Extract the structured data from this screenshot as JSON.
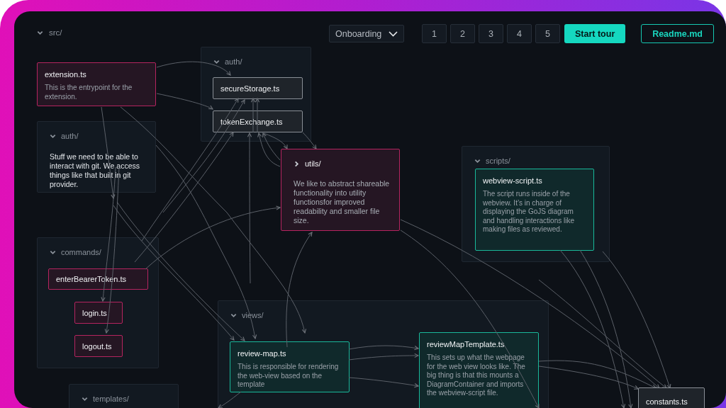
{
  "toolbar": {
    "tour_select": {
      "value": "Onboarding"
    },
    "steps": [
      {
        "label": "1",
        "selected": false
      },
      {
        "label": "2",
        "selected": false
      },
      {
        "label": "3",
        "selected": false
      },
      {
        "label": "4",
        "selected": false
      },
      {
        "label": "5",
        "selected": false
      }
    ],
    "start_button": "Start tour",
    "readme_button": "Readme.md"
  },
  "root": {
    "label": "src/",
    "expanded": true
  },
  "nodes": [
    {
      "kind": "file",
      "name": "extension.ts",
      "description": "This is the entrypoint for the extension.",
      "color": "#b5245f"
    },
    {
      "kind": "folder",
      "label": "auth/",
      "expanded": true,
      "files": [
        {
          "name": "secureStorage.ts",
          "color": "#8a8f96"
        },
        {
          "name": "tokenExchange.ts",
          "color": "#8a8f96"
        }
      ]
    },
    {
      "kind": "folder",
      "label": "auth/",
      "expanded": true,
      "description": "Stuff we need to be able to interact with git. We access things like that built in git provider."
    },
    {
      "kind": "folder",
      "label": "utils/",
      "expanded": false,
      "color": "#b5245f",
      "description": "We like to abstract shareable functionality into utility functionsfor improved readability and smaller file size."
    },
    {
      "kind": "folder",
      "label": "scripts/",
      "expanded": true,
      "files": [
        {
          "name": "webview-script.ts",
          "description": "The script runs inside of the webview. It’s in charge of displaying the GoJS diagram and handling interactions like making files as reviewed.",
          "color": "#19b89a"
        }
      ]
    },
    {
      "kind": "folder",
      "label": "commands/",
      "expanded": true,
      "files": [
        {
          "name": "enterBearerToken.ts",
          "color": "#b5245f"
        },
        {
          "name": "login.ts",
          "color": "#b5245f"
        },
        {
          "name": "logout.ts",
          "color": "#b5245f"
        }
      ]
    },
    {
      "kind": "folder",
      "label": "views/",
      "expanded": true,
      "files": [
        {
          "name": "review-map.ts",
          "description": "This is responsible for rendering the web-view based on the template",
          "color": "#19b89a"
        },
        {
          "name": "reviewMapTemplate.ts",
          "description": "This sets up what the webpage for the web view looks like. The big thing is that this mounts a DiagramContainer and imports the webview-script file.",
          "color": "#19b89a"
        }
      ]
    },
    {
      "kind": "folder",
      "label": "templates/",
      "expanded": true
    },
    {
      "kind": "file",
      "name": "constants.ts",
      "color": "#8a8f96"
    }
  ]
}
